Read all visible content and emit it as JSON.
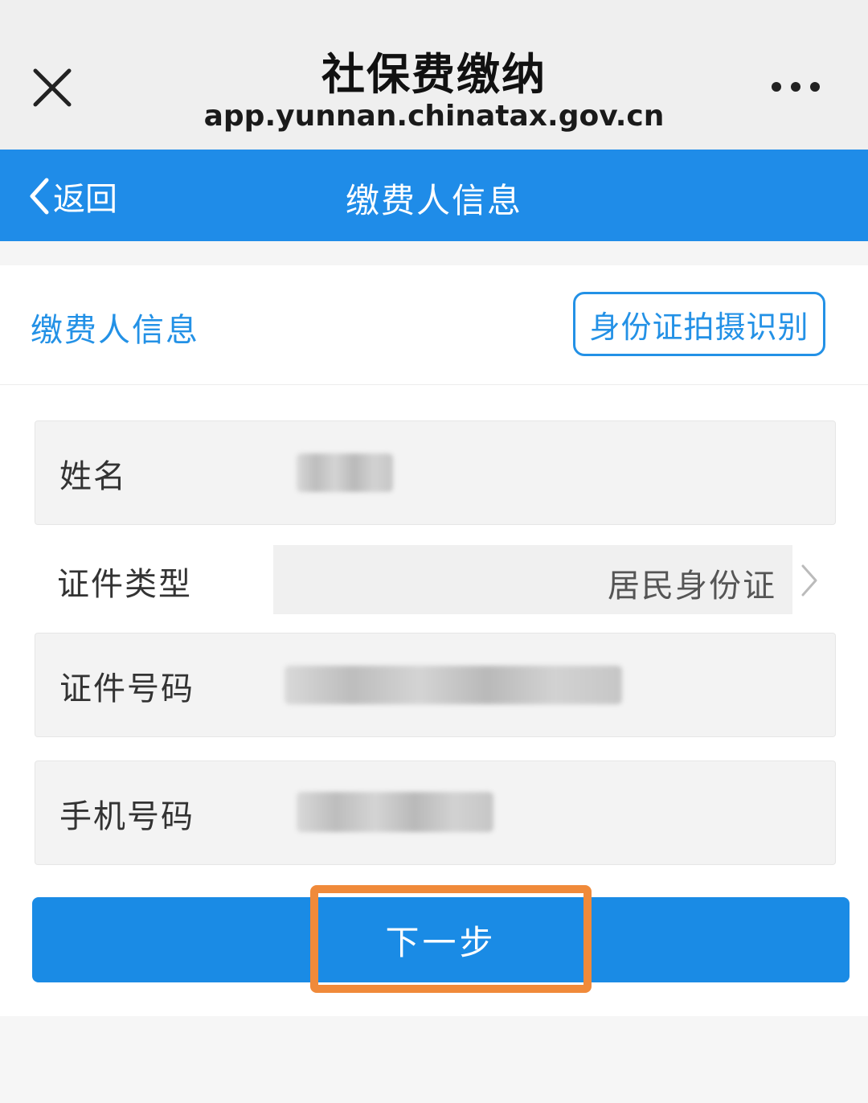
{
  "app_bar": {
    "title": "社保费缴纳",
    "url": "app.yunnan.chinatax.gov.cn",
    "close_icon": "close-icon",
    "more_icon": "more-icon"
  },
  "nav": {
    "back_label": "返回",
    "title": "缴费人信息"
  },
  "section": {
    "title": "缴费人信息",
    "scan_button_label": "身份证拍摄识别"
  },
  "form": {
    "name_label": "姓名",
    "id_type_label": "证件类型",
    "id_type_value": "居民身份证",
    "id_number_label": "证件号码",
    "phone_label": "手机号码"
  },
  "actions": {
    "next_label": "下一步"
  },
  "colors": {
    "primary": "#1f8ce8",
    "accent_text": "#2391e6",
    "highlight": "#f08a3a"
  }
}
